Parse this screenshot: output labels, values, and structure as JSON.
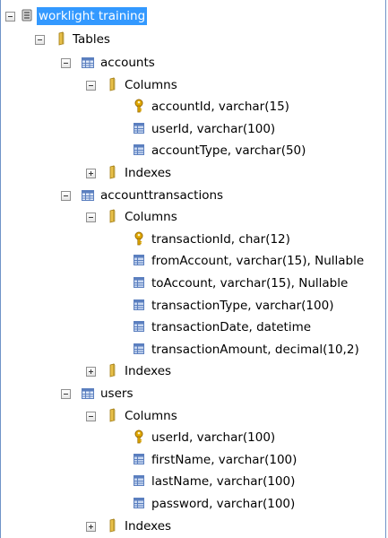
{
  "tree": {
    "database": {
      "label": "worklight training",
      "icon": "database-icon"
    },
    "tables_folder": {
      "label": "Tables",
      "icon": "folder-icon"
    },
    "tables": [
      {
        "name": "accounts",
        "columns_label": "Columns",
        "columns": [
          {
            "text": "accountId, varchar(15)",
            "key": true
          },
          {
            "text": "userId, varchar(100)",
            "key": false
          },
          {
            "text": "accountType, varchar(50)",
            "key": false
          }
        ],
        "indexes_label": "Indexes"
      },
      {
        "name": "accounttransactions",
        "columns_label": "Columns",
        "columns": [
          {
            "text": "transactionId, char(12)",
            "key": true
          },
          {
            "text": "fromAccount, varchar(15), Nullable",
            "key": false
          },
          {
            "text": "toAccount, varchar(15), Nullable",
            "key": false
          },
          {
            "text": "transactionType, varchar(100)",
            "key": false
          },
          {
            "text": "transactionDate, datetime",
            "key": false
          },
          {
            "text": "transactionAmount, decimal(10,2)",
            "key": false
          }
        ],
        "indexes_label": "Indexes"
      },
      {
        "name": "users",
        "columns_label": "Columns",
        "columns": [
          {
            "text": "userId, varchar(100)",
            "key": true
          },
          {
            "text": "firstName, varchar(100)",
            "key": false
          },
          {
            "text": "lastName, varchar(100)",
            "key": false
          },
          {
            "text": "password, varchar(100)",
            "key": false
          }
        ],
        "indexes_label": "Indexes"
      }
    ],
    "colors": {
      "selection": "#3399ff",
      "folder": "#e8c04a",
      "key": "#e0a800",
      "table_grid": "#5b7fbf"
    }
  }
}
